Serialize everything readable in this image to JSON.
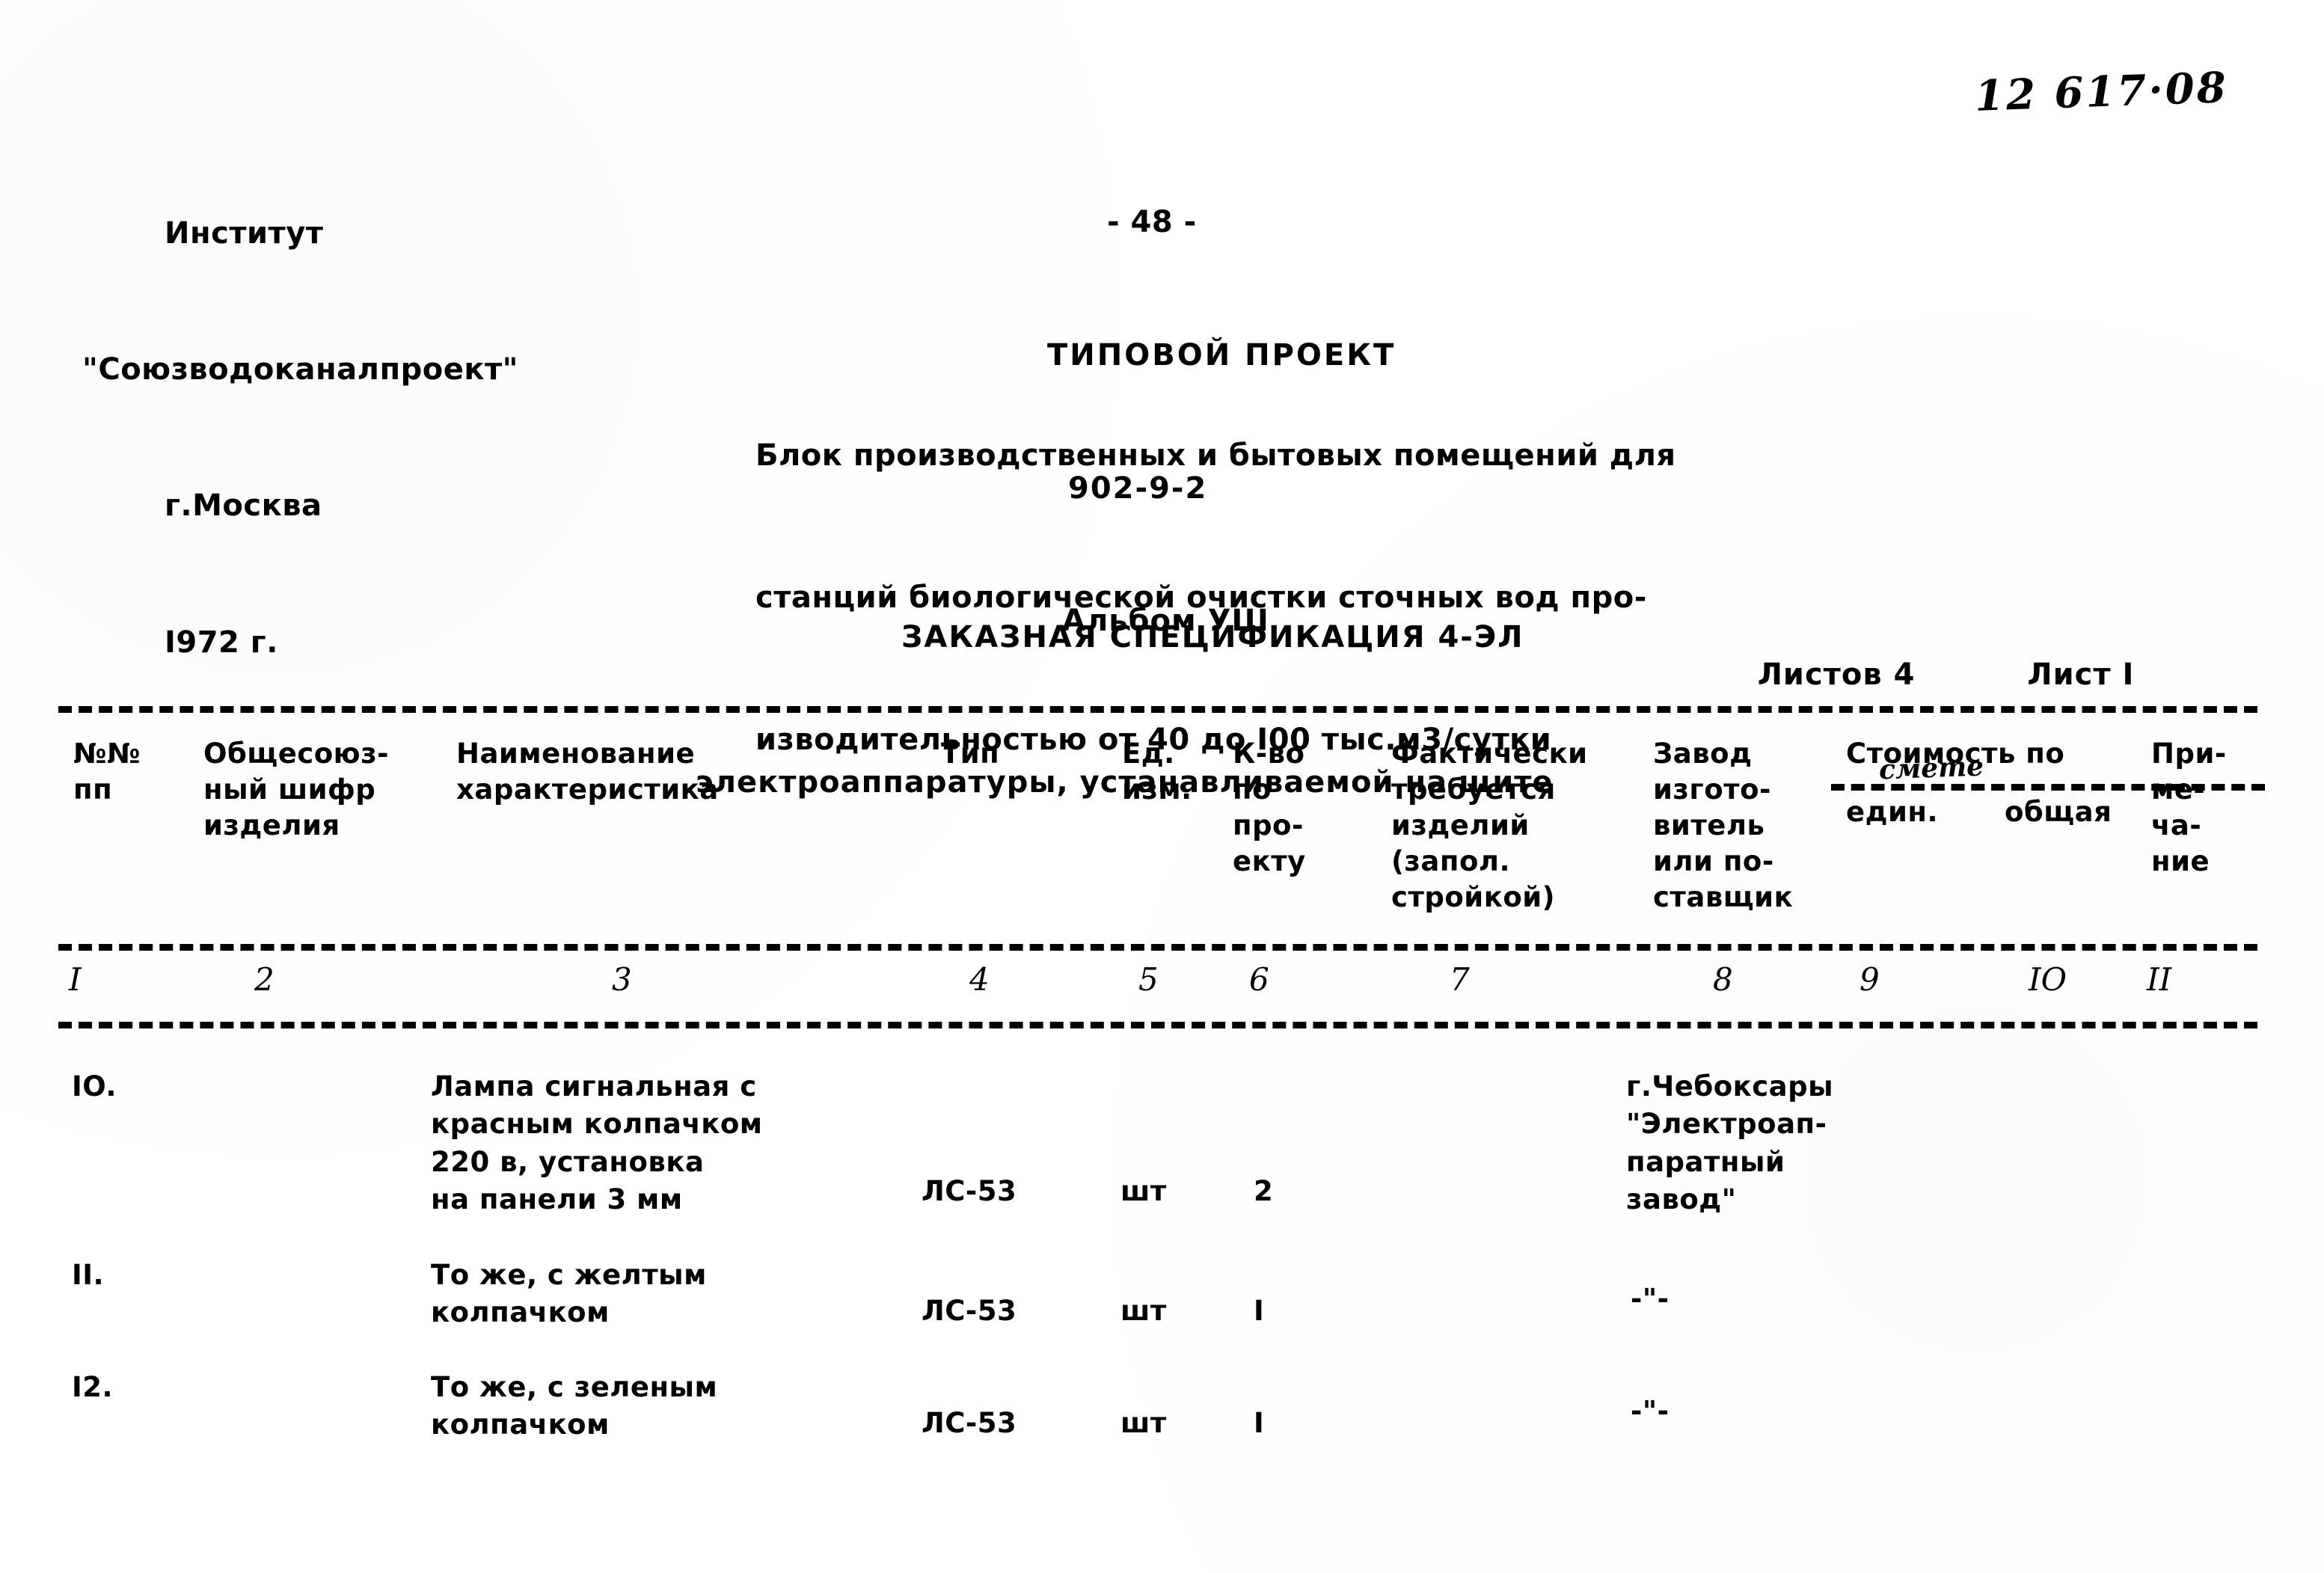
{
  "document": {
    "handwritten_doc_number": "12 617·08",
    "page_marker": "- 48 -",
    "project_title": "ТИПОВОЙ ПРОЕКТ",
    "project_code": "902-9-2",
    "album": "Альбом УШ"
  },
  "organization": {
    "line1": "Институт",
    "line2": "\"Союзводоканалпроект\"",
    "line3": "г.Москва",
    "line4": "I972 г."
  },
  "description": {
    "line1": "Блок производственных и бытовых помещений для",
    "line2": "станций биологической очистки сточных вод про-",
    "line3": "изводительностью от 40 до I00 тыс.м3/сутки"
  },
  "specification": {
    "title": "ЗАКАЗНАЯ СПЕЦИФИКАЦИЯ 4-ЭЛ",
    "subtitle": "электроаппаратуры, устанавливаемой на щите",
    "sheets_total_label": "Листов 4",
    "sheet_current_label": "Лист I"
  },
  "table": {
    "headers": {
      "col1": "№№\nпп",
      "col2": "Общесоюз-\nный шифр\nизделия",
      "col3": "Наименование\nхарактеристика",
      "col4": "Тип",
      "col5": "Ед.\nизм.",
      "col6": "К-во\nпо\nпро-\nекту",
      "col7": "Фактически\nтребуется\nизделий\n(запол.\nстройкой)",
      "col8": "Завод\nизгото-\nвитель\nили по-\nставщик",
      "cost_group": "Стоимость по",
      "cost_group_handwritten": "смете",
      "col9": "един.",
      "col10": "общая",
      "col11": "При-\nме-\nча-\nние"
    },
    "column_numbers": [
      "I",
      "2",
      "3",
      "4",
      "5",
      "6",
      "7",
      "8",
      "9",
      "IO",
      "II"
    ],
    "rows": [
      {
        "num": "IO.",
        "code": "",
        "name": "Лампа сигнальная с\nкрасным колпачком\n220 в, установка\nна панели 3 мм",
        "type": "ЛС-53",
        "unit": "шт",
        "qty": "2",
        "actual": "",
        "manufacturer": "г.Чебоксары\n\"Электроап-\nпаратный\nзавод\"",
        "cost_unit": "",
        "cost_total": "",
        "note": ""
      },
      {
        "num": "II.",
        "code": "",
        "name": "То же, с желтым\nколпачком",
        "type": "ЛС-53",
        "unit": "шт",
        "qty": "I",
        "actual": "",
        "manufacturer": "-\"-",
        "cost_unit": "",
        "cost_total": "",
        "note": ""
      },
      {
        "num": "I2.",
        "code": "",
        "name": "То же, с зеленым\nколпачком",
        "type": "ЛС-53",
        "unit": "шт",
        "qty": "I",
        "actual": "",
        "manufacturer": "-\"-",
        "cost_unit": "",
        "cost_total": "",
        "note": ""
      }
    ]
  }
}
